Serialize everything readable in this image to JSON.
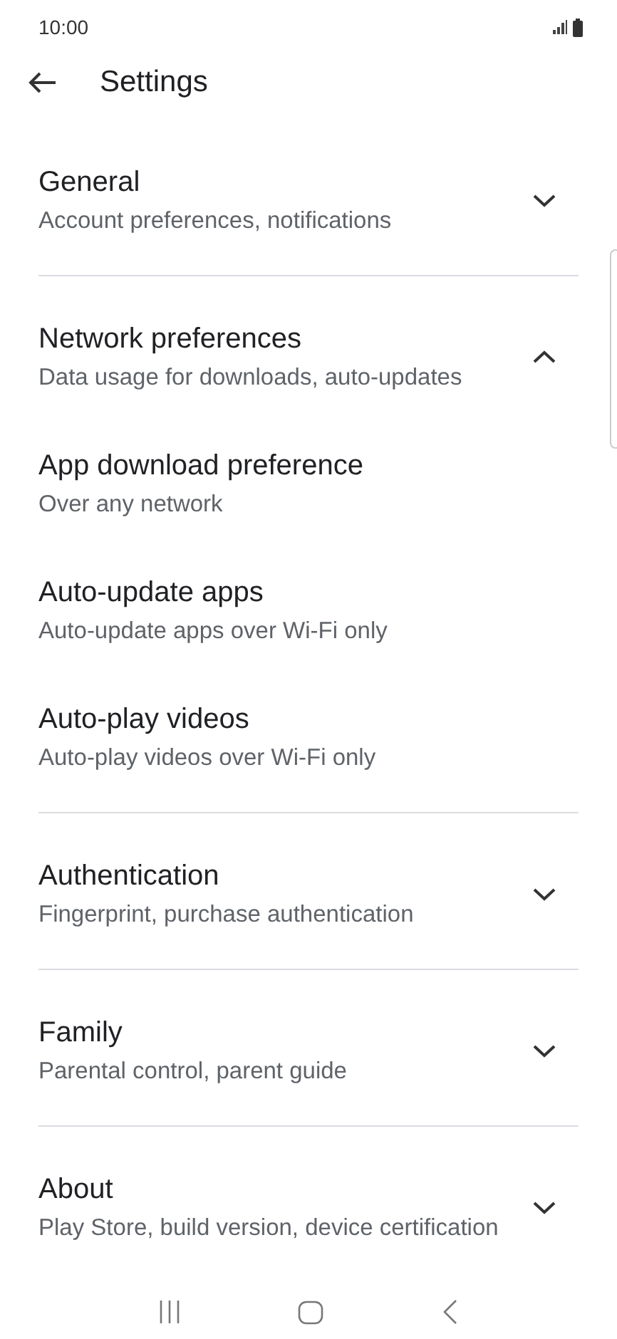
{
  "status_bar": {
    "time": "10:00"
  },
  "header": {
    "title": "Settings"
  },
  "sections": [
    {
      "title": "General",
      "subtitle": "Account preferences, notifications",
      "expanded": false
    },
    {
      "title": "Network preferences",
      "subtitle": "Data usage for downloads, auto-updates",
      "expanded": true,
      "items": [
        {
          "title": "App download preference",
          "subtitle": "Over any network"
        },
        {
          "title": "Auto-update apps",
          "subtitle": "Auto-update apps over Wi-Fi only"
        },
        {
          "title": "Auto-play videos",
          "subtitle": "Auto-play videos over Wi-Fi only"
        }
      ]
    },
    {
      "title": "Authentication",
      "subtitle": "Fingerprint, purchase authentication",
      "expanded": false
    },
    {
      "title": "Family",
      "subtitle": "Parental control, parent guide",
      "expanded": false
    },
    {
      "title": "About",
      "subtitle": "Play Store, build version, device certification",
      "expanded": false
    }
  ]
}
